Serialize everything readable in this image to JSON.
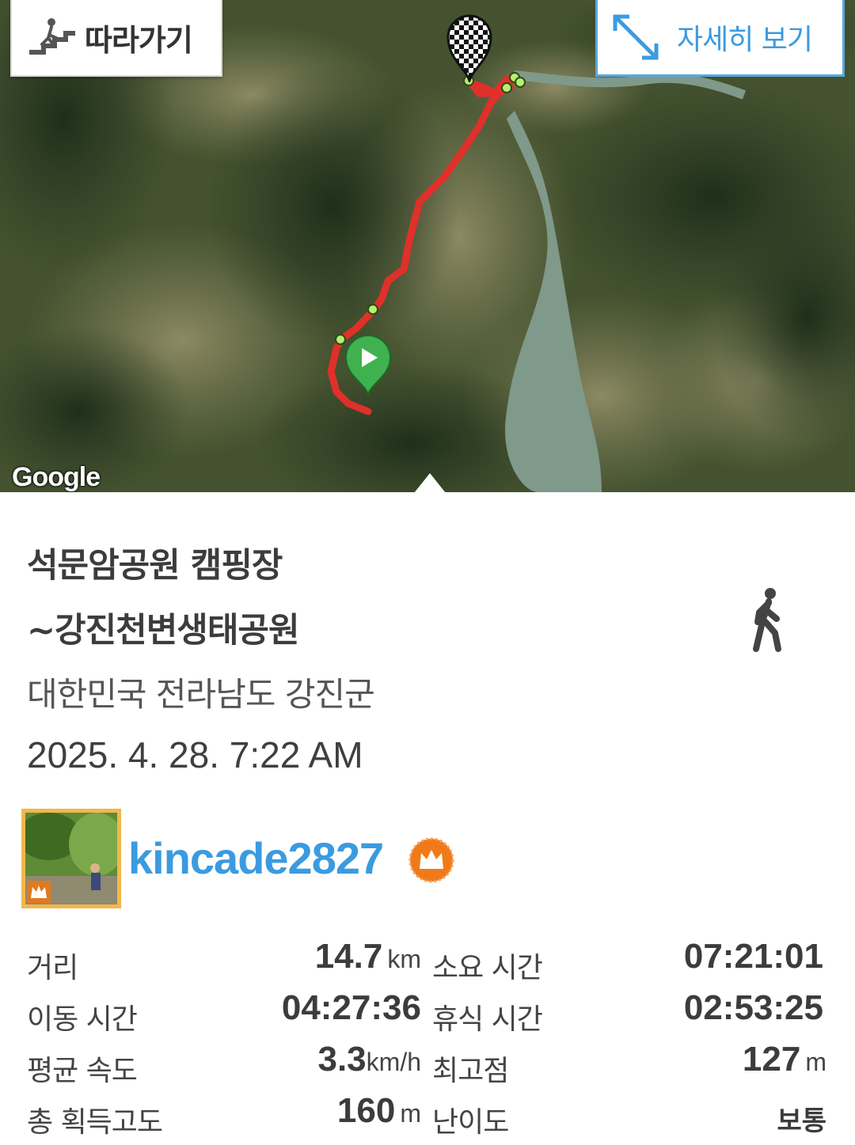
{
  "map": {
    "follow_label": "따라가기",
    "detail_label": "자세히 보기",
    "provider_logo": "Google",
    "route_color": "#e0302a",
    "start_marker_color": "#3fb24f",
    "icons": {
      "follow": "hiker-stairs-icon",
      "detail": "expand-arrows-icon",
      "finish": "checkered-flag-icon",
      "start": "play-marker-icon"
    }
  },
  "track": {
    "title_line1": "석문암공원 캠핑장",
    "title_line2": "~강진천변생태공원",
    "activity_icon": "walking-person-icon",
    "location": "대한민국 전라남도 강진군",
    "datetime": "2025. 4. 28. 7:22 AM"
  },
  "user": {
    "username": "kincade2827",
    "badge_icon": "crown-icon",
    "badge_color": "#f07a1a",
    "name_color": "#3b9be0"
  },
  "stats": [
    {
      "label": "거리",
      "value": "14.7",
      "unit": "km",
      "label2": "소요 시간",
      "value2": "07:21:01",
      "unit2": ""
    },
    {
      "label": "이동 시간",
      "value": "04:27:36",
      "unit": "",
      "label2": "휴식 시간",
      "value2": "02:53:25",
      "unit2": ""
    },
    {
      "label": "평균 속도",
      "value": "3.3",
      "unit": "km/h",
      "label2": "최고점",
      "value2": "127",
      "unit2": "m"
    },
    {
      "label": "총 획득고도",
      "value": "160",
      "unit": "m",
      "label2": "난이도",
      "value2": "보통",
      "unit2": ""
    }
  ]
}
